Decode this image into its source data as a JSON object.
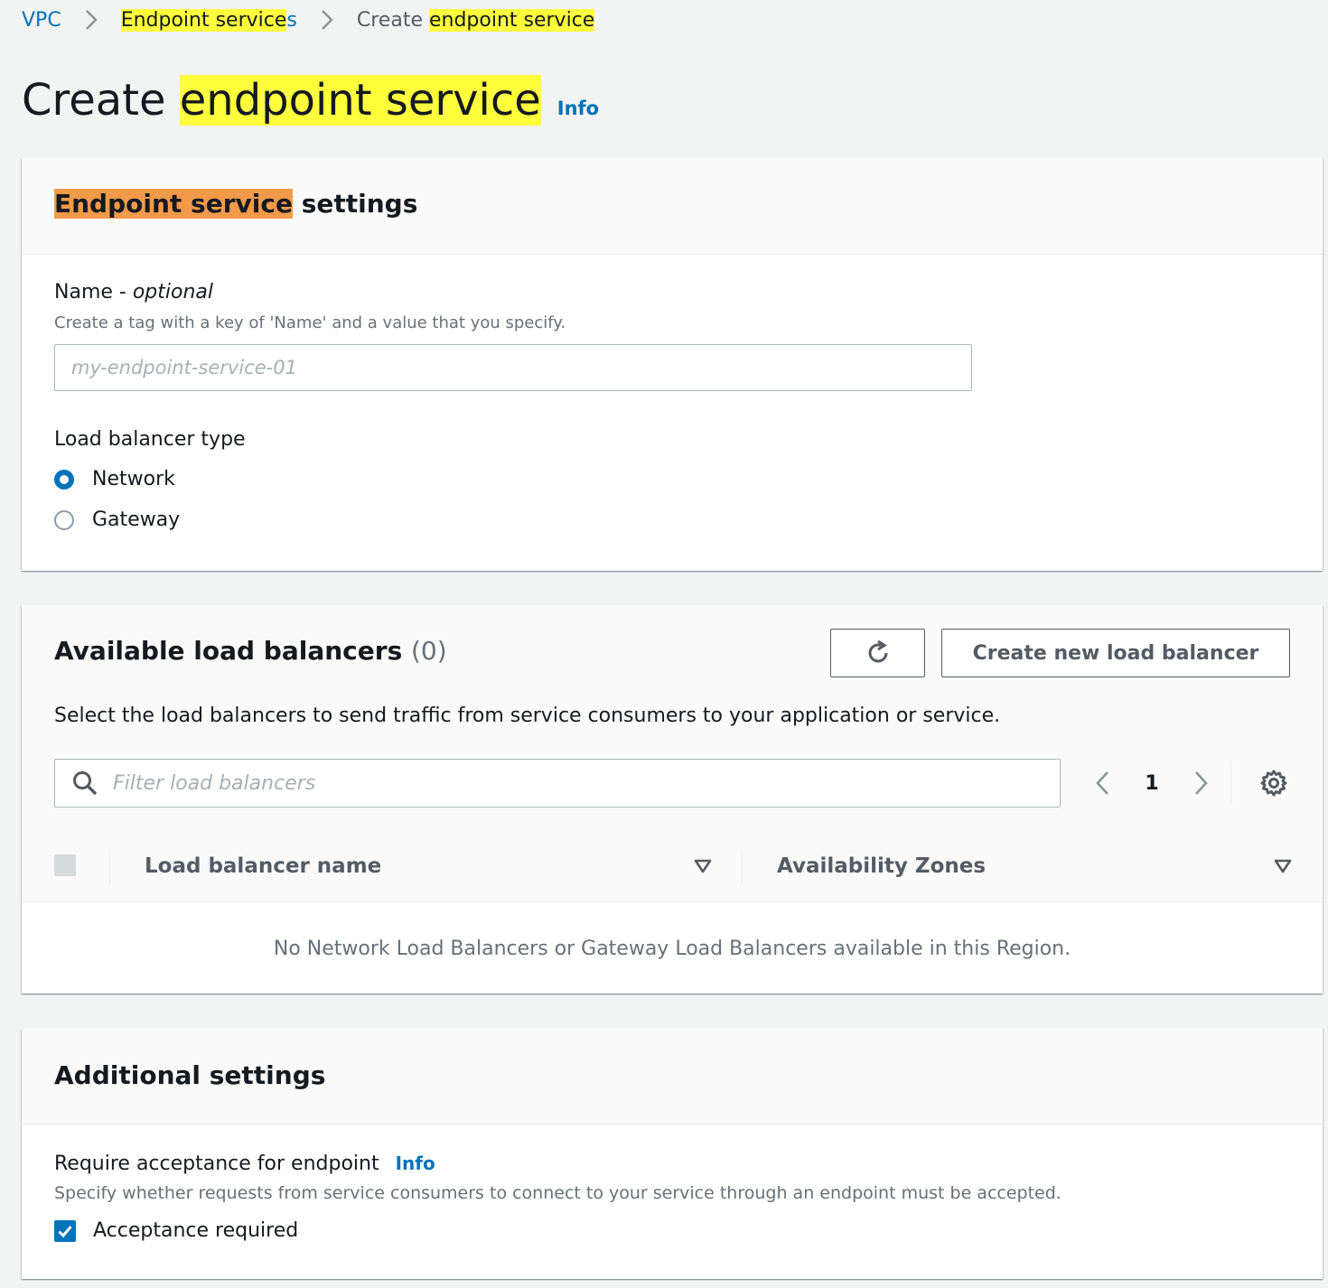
{
  "breadcrumb": {
    "vpc": "VPC",
    "endpoint_services_highlighted": "Endpoint service",
    "endpoint_services_rest": "s",
    "create_prefix": "Create ",
    "create_highlighted": "endpoint service"
  },
  "header": {
    "title_prefix": "Create ",
    "title_highlighted": "endpoint service",
    "info": "Info"
  },
  "settings_panel": {
    "title_highlighted": "Endpoint service",
    "title_rest": " settings",
    "name_label": "Name - ",
    "name_label_optional": "optional",
    "name_description": "Create a tag with a key of 'Name' and a value that you specify.",
    "name_placeholder": "my-endpoint-service-01",
    "name_value": "",
    "lb_type_label": "Load balancer type",
    "lb_type_options": [
      {
        "label": "Network",
        "checked": true
      },
      {
        "label": "Gateway",
        "checked": false
      }
    ]
  },
  "load_balancers_panel": {
    "title": "Available load balancers",
    "count": "(0)",
    "refresh_icon": "refresh-icon",
    "create_button": "Create new load balancer",
    "description": "Select the load balancers to send traffic from service consumers to your application or service.",
    "filter_placeholder": "Filter load balancers",
    "current_page": "1",
    "columns": [
      "Load balancer name",
      "Availability Zones"
    ],
    "empty_message": "No Network Load Balancers or Gateway Load Balancers available in this Region."
  },
  "additional_panel": {
    "title": "Additional settings",
    "acceptance_label": "Require acceptance for endpoint",
    "info": "Info",
    "acceptance_description": "Specify whether requests from service consumers to connect to your service through an endpoint must be accepted.",
    "checkbox_label": "Acceptance required",
    "checkbox_checked": true
  },
  "colors": {
    "link": "#0073bb",
    "highlight_yellow": "#ffff3d",
    "highlight_orange": "#f39a4a",
    "background": "#f2f3f3"
  }
}
